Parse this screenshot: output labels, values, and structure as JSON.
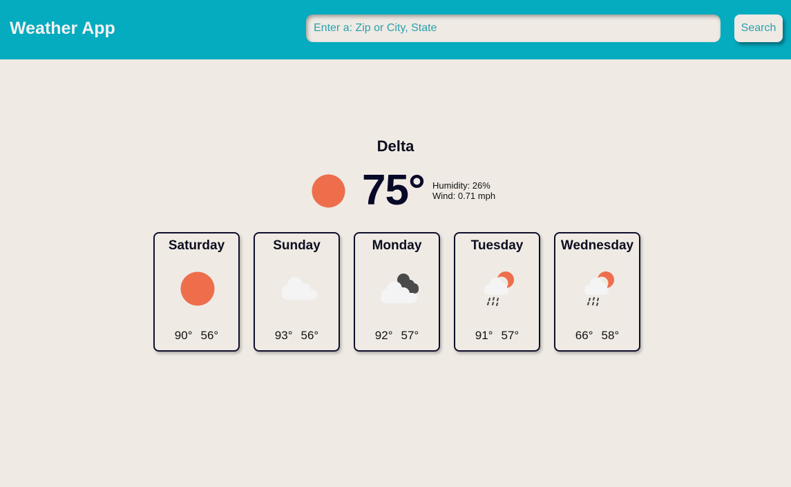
{
  "header": {
    "title": "Weather App",
    "search_placeholder": "Enter a: Zip or City, State",
    "search_value": "",
    "search_label": "Search"
  },
  "colors": {
    "header_bg": "#05abbf",
    "page_bg": "#efeae4",
    "accent_text": "#2aa0ad",
    "sun": "#ee6e4c",
    "cloud_light": "#f4f4f4",
    "cloud_dark": "#4a4a4a"
  },
  "current": {
    "city": "Delta",
    "icon": "sun-icon",
    "temperature": "75°",
    "humidity": "Humidity: 26%",
    "wind": "Wind: 0.71 mph"
  },
  "forecast": [
    {
      "day": "Saturday",
      "icon": "sun-icon",
      "high": "90°",
      "low": "56°"
    },
    {
      "day": "Sunday",
      "icon": "cloud-icon",
      "high": "93°",
      "low": "56°"
    },
    {
      "day": "Monday",
      "icon": "cloudy-dark-icon",
      "high": "92°",
      "low": "57°"
    },
    {
      "day": "Tuesday",
      "icon": "rain-sun-icon",
      "high": "91°",
      "low": "57°"
    },
    {
      "day": "Wednesday",
      "icon": "rain-sun-icon",
      "high": "66°",
      "low": "58°"
    }
  ]
}
